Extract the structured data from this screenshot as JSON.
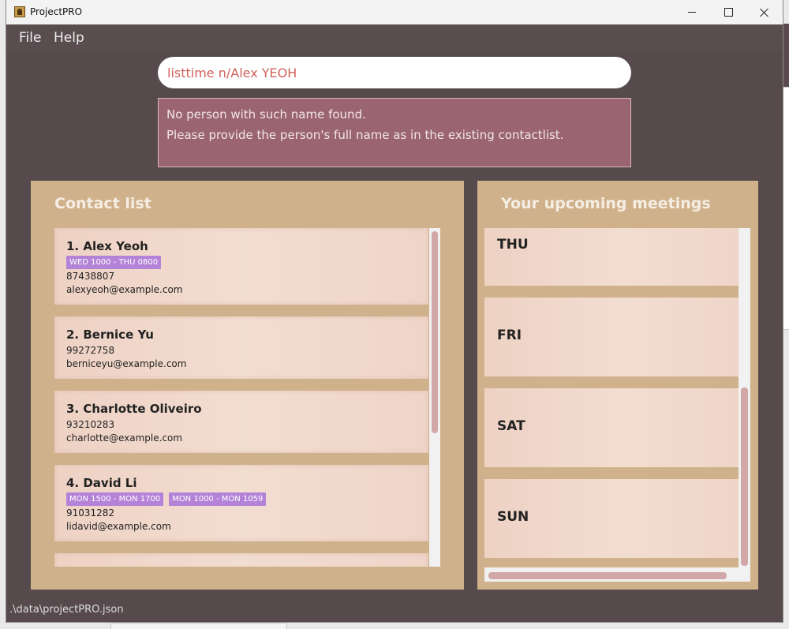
{
  "window": {
    "title": "ProjectPRO"
  },
  "menu": {
    "file": "File",
    "help": "Help"
  },
  "command": {
    "value": "listtime n/Alex YEOH"
  },
  "result": {
    "line1": "No person with such name found.",
    "line2": "Please provide the person's full name as in the existing contactlist."
  },
  "contacts": {
    "title": "Contact list",
    "items": [
      {
        "name": "1.  Alex Yeoh",
        "tags": [
          "WED 1000 - THU 0800"
        ],
        "phone": "87438807",
        "email": "alexyeoh@example.com"
      },
      {
        "name": "2.  Bernice Yu",
        "tags": [],
        "phone": "99272758",
        "email": "berniceyu@example.com"
      },
      {
        "name": "3.  Charlotte Oliveiro",
        "tags": [],
        "phone": "93210283",
        "email": "charlotte@example.com"
      },
      {
        "name": "4.  David Li",
        "tags": [
          "MON 1500 - MON 1700",
          "MON 1000 - MON 1059"
        ],
        "phone": "91031282",
        "email": "lidavid@example.com"
      }
    ]
  },
  "meetings": {
    "title": "Your upcoming meetings",
    "days": [
      "THU",
      "FRI",
      "SAT",
      "SUN"
    ]
  },
  "status": {
    "path": ".\\data\\projectPRO.json"
  },
  "colors": {
    "window_bg": "#564a4d",
    "panel": "#cfb18b",
    "card": "#f2ddd1",
    "tag": "#b483d8",
    "result_bg": "#9a6470",
    "command_text": "#d0605a",
    "scroll_thumb": "#d2a7a7"
  }
}
